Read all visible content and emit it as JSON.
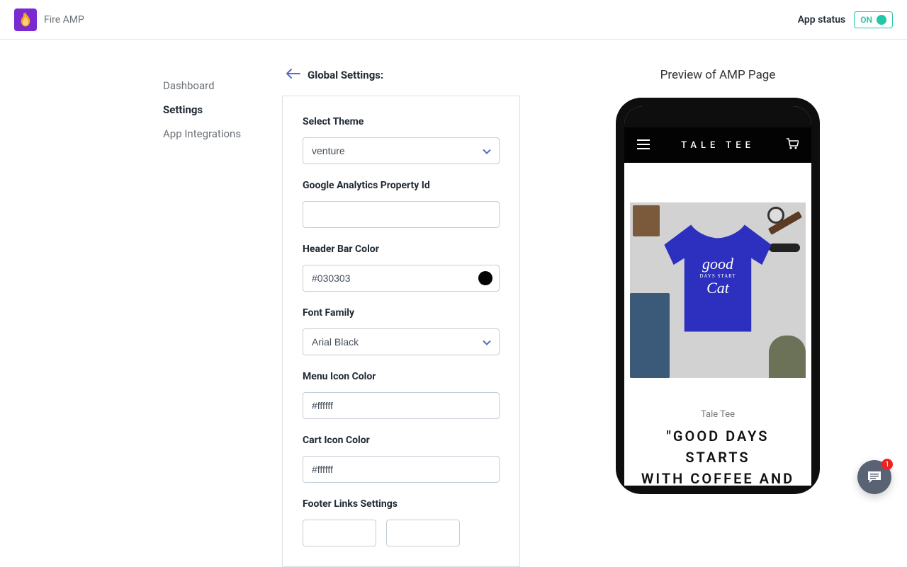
{
  "header": {
    "app_name": "Fire AMP",
    "status_label": "App status",
    "status_text": "ON"
  },
  "sidebar": {
    "items": [
      {
        "label": "Dashboard"
      },
      {
        "label": "Settings"
      },
      {
        "label": "App Integrations"
      }
    ]
  },
  "page": {
    "back_title": "Global Settings:"
  },
  "form": {
    "select_theme_label": "Select Theme",
    "select_theme_value": "venture",
    "ga_label": "Google Analytics Property Id",
    "ga_value": "",
    "header_bar_color_label": "Header Bar Color",
    "header_bar_color_value": "#030303",
    "font_family_label": "Font Family",
    "font_family_value": "Arial Black",
    "menu_icon_color_label": "Menu Icon Color",
    "menu_icon_color_value": "#ffffff",
    "cart_icon_color_label": "Cart Icon Color",
    "cart_icon_color_value": "#ffffff",
    "footer_links_label": "Footer Links Settings"
  },
  "preview": {
    "title": "Preview of AMP Page",
    "store_name": "TALE TEE",
    "brand_small": "Tale Tee",
    "product_title_line1": "\"GOOD DAYS STARTS",
    "product_title_line2": "WITH COFFEE AND",
    "shirt_line1": "good",
    "shirt_line2": "DAYS START",
    "shirt_line3": "Cat"
  },
  "chat": {
    "badge": "1"
  }
}
